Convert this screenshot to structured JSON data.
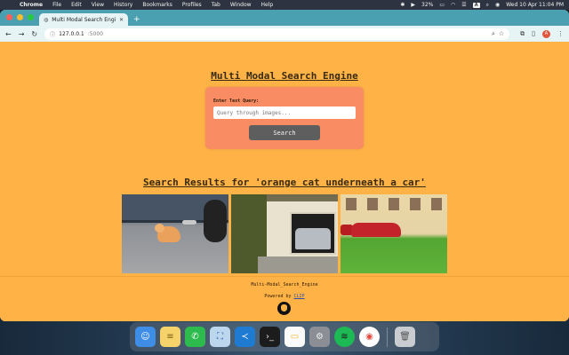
{
  "menubar": {
    "app_name": "Chrome",
    "items": [
      "File",
      "Edit",
      "View",
      "History",
      "Bookmarks",
      "Profiles",
      "Tab",
      "Window",
      "Help"
    ],
    "battery": "32%",
    "input_badge": "A",
    "datetime": "Wed 10 Apr  11:04 PM"
  },
  "browser": {
    "tab_title": "Multi Modal Search Engine",
    "url_host": "127.0.0.1",
    "url_port": ":5000",
    "profile_initial": "A"
  },
  "page": {
    "title": "Multi Modal Search Engine",
    "query_label": "Enter Text Query:",
    "query_placeholder": "Query through images...",
    "search_button": "Search",
    "results_heading": "Search Results for 'orange cat underneath a car'",
    "results": [
      "img1",
      "img2",
      "img3"
    ],
    "footer_name": "Multi-Modal_Search_Engine",
    "footer_powered": "Powered by ",
    "footer_link": "CLIP"
  },
  "dock": {
    "apps": [
      "finder",
      "notes",
      "whatsapp",
      "preview",
      "vscode",
      "terminal",
      "notes-app",
      "system-settings",
      "spotify",
      "chrome",
      "trash"
    ]
  },
  "colors": {
    "page_bg": "#ffb347",
    "card_bg": "#f98c63",
    "button_bg": "#5f5e5e",
    "tabstrip": "#4a9fb0"
  }
}
